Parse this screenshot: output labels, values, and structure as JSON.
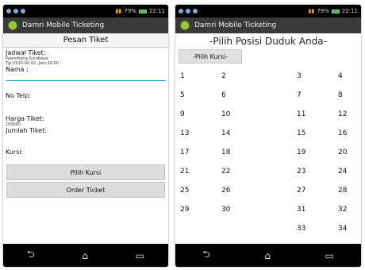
{
  "left": {
    "status_time": "22:11",
    "status_battery": "79%",
    "app_title": "Damri Mobile Ticketing",
    "header": "Pesan Tiket",
    "jadwal_label": "Jadwal Tiket:",
    "jadwal_route": "Palembang-Surabaya",
    "jadwal_date": "Tgl:2015-02-02, Jam:10.00",
    "nama_label": "Nama :",
    "telp_label": "No Telp:",
    "harga_label": "Harga Tiket:",
    "harga_value": "100000",
    "jumlah_label": "Jumlah Tiket:",
    "kursi_label": "Kursi:",
    "kursi_value": "-",
    "pilih_kursi_button": "Pilih Kursi",
    "order_button": "Order Ticket"
  },
  "right": {
    "status_time": "22:11",
    "status_battery": "79%",
    "app_title": "Damri Mobile Ticketing",
    "header": "-Pilih Posisi Duduk Anda-",
    "pick_button": "-Pilih Kursi-",
    "seats": [
      [
        "1",
        "2",
        "3",
        "4"
      ],
      [
        "5",
        "6",
        "7",
        "8"
      ],
      [
        "9",
        "10",
        "11",
        "12"
      ],
      [
        "13",
        "14",
        "15",
        "16"
      ],
      [
        "17",
        "18",
        "19",
        "20"
      ],
      [
        "21",
        "22",
        "23",
        "24"
      ],
      [
        "25",
        "26",
        "27",
        "28"
      ],
      [
        "29",
        "30",
        "31",
        "32"
      ],
      [
        "",
        "",
        "33",
        "34"
      ]
    ]
  },
  "nav_icons": [
    "back-icon",
    "home-icon",
    "recents-icon"
  ]
}
